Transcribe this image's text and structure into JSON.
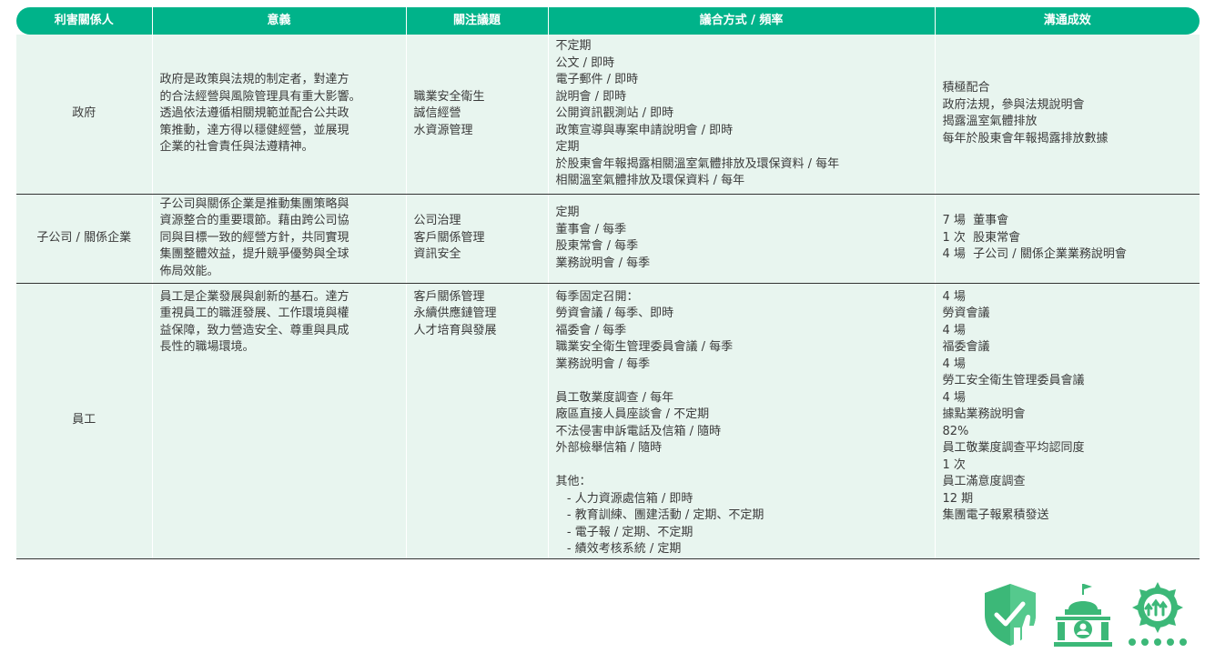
{
  "headers": [
    "利害關係人",
    "意義",
    "關注議題",
    "議合方式 / 頻率",
    "溝通成效"
  ],
  "rows": [
    {
      "stakeholder": "政府",
      "meaning": [
        "政府是政策與法規的制定者，對達方",
        "的合法經營與風險管理具有重大影響。",
        "透過依法遵循相關規範並配合公共政",
        "策推動，達方得以穩健經營，並展現",
        "企業的社會責任與法遵精神。"
      ],
      "issues": [
        "職業安全衛生",
        "誠信經營",
        "水資源管理"
      ],
      "methods": [
        "不定期",
        "公文 / 即時",
        "電子郵件 / 即時",
        "說明會 / 即時",
        "公開資訊觀測站 / 即時",
        "政策宣導與專案申請說明會 / 即時",
        "定期",
        "於股東會年報揭露相關溫室氣體排放及環保資料 / 每年",
        "相關溫室氣體排放及環保資料 / 每年"
      ],
      "results": [
        "積極配合",
        "政府法規，參與法規說明會",
        "揭露溫室氣體排放",
        "每年於股東會年報揭露排放數據"
      ]
    },
    {
      "stakeholder": "子公司 / 關係企業",
      "meaning": [
        "子公司與關係企業是推動集團策略與",
        "資源整合的重要環節。藉由跨公司協",
        "同與目標一致的經營方針，共同實現",
        "集團整體效益，提升競爭優勢與全球",
        "佈局效能。"
      ],
      "issues": [
        "公司治理",
        "客戶關係管理",
        "資訊安全"
      ],
      "methods": [
        "定期",
        "董事會 / 每季",
        "股東常會 / 每季",
        "業務說明會 / 每季"
      ],
      "results": [
        "7 場  董事會",
        "1 次  股東常會",
        "4 場  子公司 / 關係企業業務說明會"
      ]
    },
    {
      "stakeholder": "員工",
      "meaning": [
        "員工是企業發展與創新的基石。達方",
        "重視員工的職涯發展、工作環境與權",
        "益保障，致力營造安全、尊重與具成",
        "長性的職場環境。"
      ],
      "issues": [
        "客戶關係管理",
        "永續供應鏈管理",
        "人才培育與發展"
      ],
      "methods": [
        "每季固定召開：",
        "勞資會議 / 每季、即時",
        "福委會 / 每季",
        "職業安全衛生管理委員會議 / 每季",
        "業務說明會 / 每季",
        " ",
        "員工敬業度調查 / 每年",
        "廠區直接人員座談會 / 不定期",
        "不法侵害申訴電話及信箱 / 隨時",
        "外部檢舉信箱 / 隨時",
        " ",
        "其他：",
        "   - 人力資源處信箱 / 即時",
        "   - 教育訓練、團建活動 / 定期、不定期",
        "   - 電子報 / 定期、不定期",
        "   - 績效考核系統 / 定期"
      ],
      "results": [
        "4 場",
        "勞資會議",
        "4 場",
        "福委會議",
        "4 場",
        "勞工安全衛生管理委員會議",
        "4 場",
        "據點業務說明會",
        "82%",
        "員工敬業度調查平均認同度",
        "1 次",
        "員工滿意度調查",
        "12 期",
        "集團電子報累積發送"
      ]
    }
  ],
  "icons": [
    "shield-check-thumbs-up-icon",
    "government-building-icon",
    "growth-badge-stars-icon"
  ],
  "colors": {
    "header_bg": "#00b38a",
    "row_bg": "#e8f5ef",
    "icon_green": "#3cb878"
  }
}
